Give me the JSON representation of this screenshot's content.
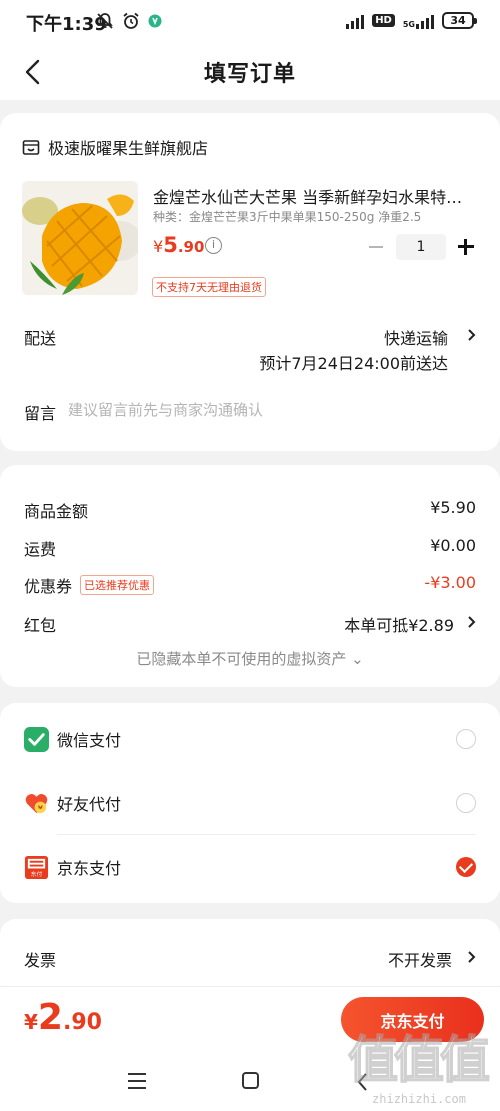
{
  "status_bar": {
    "time": "下午1:39",
    "network_label": "5G",
    "hd_label": "HD",
    "battery": "34"
  },
  "header": {
    "title": "填写订单"
  },
  "store": {
    "name": "极速版曜果生鲜旗舰店"
  },
  "product": {
    "title": "金煌芒水仙芒大芒果 当季新鲜孕妇水果特…",
    "spec": "种类：金煌芒芒果3斤中果单果150-250g 净重2.5",
    "price_symbol": "¥",
    "price_int": "5",
    "price_dec": ".90",
    "quantity": "1",
    "return_badge": "不支持7天无理由退货"
  },
  "shipping": {
    "label": "配送",
    "method": "快递运输",
    "eta": "预计7月24日24:00前送达"
  },
  "note": {
    "label": "留言",
    "placeholder": "建议留言前先与商家沟通确认"
  },
  "amounts": {
    "goods_label": "商品金额",
    "goods_value": "¥5.90",
    "freight_label": "运费",
    "freight_value": "¥0.00",
    "coupon_label": "优惠券",
    "coupon_tag": "已选推荐优惠",
    "coupon_value": "-¥3.00",
    "redpacket_label": "红包",
    "redpacket_value": "本单可抵¥2.89",
    "hidden_assets": "已隐藏本单不可使用的虚拟资产 ⌄"
  },
  "payment": {
    "options": [
      {
        "label": "微信支付",
        "checked": false
      },
      {
        "label": "好友代付",
        "checked": false
      },
      {
        "label": "京东支付",
        "checked": true
      }
    ],
    "jd_icon_text": "东付"
  },
  "invoice": {
    "label": "发票",
    "value": "不开发票"
  },
  "footer": {
    "total_symbol": "¥",
    "total_int": "2",
    "total_dec": ".90",
    "pay_button": "京东支付"
  },
  "watermark": {
    "logo": "值值值",
    "url": "zhizhizhi.com"
  },
  "colors": {
    "accent": "#e93b1d",
    "wechat": "#2aae67",
    "background": "#f2f2f2"
  }
}
